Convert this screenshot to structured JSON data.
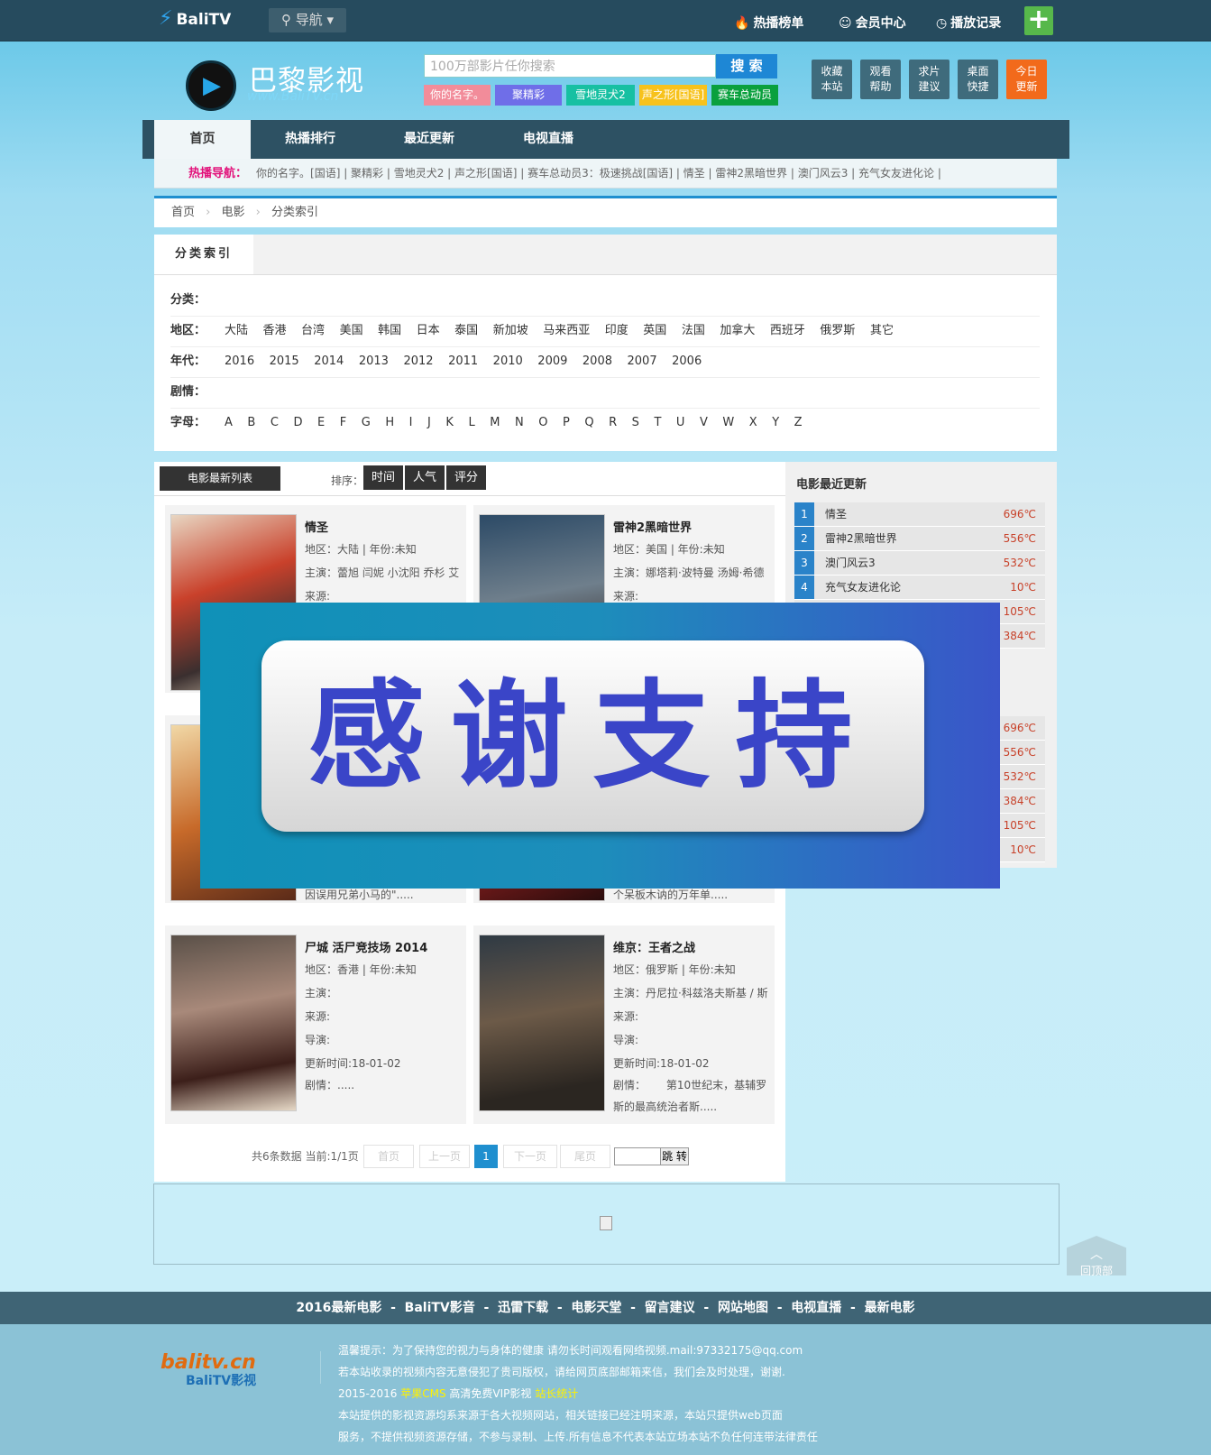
{
  "topbar": {
    "site_name": "BaliTV",
    "nav_dropdown": "导航",
    "links": [
      "热播榜单",
      "会员中心",
      "播放记录"
    ]
  },
  "header": {
    "logo_title": "巴黎影视",
    "logo_url": "www.BaliTV.cn",
    "search_placeholder": "100万部影片任你搜索",
    "search_button": "搜 索",
    "hot_tags": [
      "你的名字。",
      "聚精彩",
      "雪地灵犬2",
      "声之形[国语]",
      "赛车总动员"
    ],
    "tiles": [
      {
        "l1": "收藏",
        "l2": "本站"
      },
      {
        "l1": "观看",
        "l2": "帮助"
      },
      {
        "l1": "求片",
        "l2": "建议"
      },
      {
        "l1": "桌面",
        "l2": "快捷"
      },
      {
        "l1": "今日",
        "l2": "更新"
      }
    ]
  },
  "nav": {
    "tabs": [
      "首页",
      "热播排行",
      "最近更新",
      "电视直播"
    ],
    "hot_label": "热播导航：",
    "hot_items": "你的名字。[国语] | 聚精彩 | 雪地灵犬2 | 声之形[国语] | 赛车总动员3：极速挑战[国语] | 情圣 | 雷神2黑暗世界 | 澳门风云3 | 充气女友进化论 |"
  },
  "breadcrumb": [
    "首页",
    "电影",
    "分类索引"
  ],
  "filter": {
    "title": "分类索引",
    "rows": [
      {
        "key": "分类：",
        "values": ""
      },
      {
        "key": "地区：",
        "values": "大陆    香港    台湾    美国    韩国    日本    泰国    新加坡    马来西亚    印度    英国    法国    加拿大    西班牙    俄罗斯    其它"
      },
      {
        "key": "年代：",
        "values": "2016    2015    2014    2013    2012    2011    2010    2009    2008    2007    2006"
      },
      {
        "key": "剧情：",
        "values": ""
      },
      {
        "key": "字母：",
        "values": "A    B    C    D    E    F    G    H    I    J    K    L    M    N    O    P    Q    R    S    T    U    V    W    X    Y    Z"
      }
    ]
  },
  "list": {
    "header": "电影最新列表",
    "sort_label": "排序：",
    "sort_buttons": [
      "时间",
      "人气",
      "评分"
    ],
    "cards": [
      {
        "title": "情圣",
        "region": "地区：大陆 | 年份:未知",
        "cast": "主演：蕾旭 闫妮 小沈阳 乔杉 艾",
        "source": "来源:",
        "director": "",
        "updated": "",
        "plot": ""
      },
      {
        "title": "雷神2黑暗世界",
        "region": "地区：美国 | 年份:未知",
        "cast": "主演：娜塔莉·波特曼 汤姆·希德",
        "source": "来源:",
        "director": "",
        "updated": "",
        "plot": ""
      },
      {
        "title": "",
        "region": "",
        "cast": "",
        "source": "",
        "director": "",
        "updated": "",
        "plot": "因误用兄弟小马的\"....."
      },
      {
        "title": "",
        "region": "",
        "cast": "",
        "source": "",
        "director": "",
        "updated": "",
        "plot": "个呆板木讷的万年单....."
      },
      {
        "title": "尸城 活尸竞技场 2014",
        "region": "地区：香港 | 年份:未知",
        "cast": "主演：",
        "source": "来源:",
        "director": "导演:",
        "updated": "更新时间:18-01-02",
        "plot": "剧情：....."
      },
      {
        "title": "维京：王者之战",
        "region": "地区：俄罗斯 | 年份:未知",
        "cast": "主演：丹尼拉·科兹洛夫斯基 / 斯",
        "source": "来源:",
        "director": "导演:",
        "updated": "更新时间:18-01-02",
        "plot": "剧情：      第10世纪末，基辅罗",
        "plot2": "斯的最高统治者斯....."
      }
    ]
  },
  "sidebar": {
    "title": "电影最近更新",
    "top": [
      {
        "n": "1",
        "t": "情圣",
        "h": "696℃"
      },
      {
        "n": "2",
        "t": "雷神2黑暗世界",
        "h": "556℃"
      },
      {
        "n": "3",
        "t": "澳门风云3",
        "h": "532℃"
      },
      {
        "n": "4",
        "t": "充气女友进化论",
        "h": "10℃"
      },
      {
        "n": "",
        "t": "",
        "h": "105℃"
      },
      {
        "n": "",
        "t": "",
        "h": "384℃"
      }
    ],
    "bottom": [
      "696℃",
      "556℃",
      "532℃",
      "384℃",
      "105℃",
      "10℃"
    ]
  },
  "pager": {
    "info": "共6条数据 当前:1/1页",
    "first": "首页",
    "prev": "上一页",
    "current": "1",
    "next": "下一页",
    "last": "尾页",
    "jump": "跳 转"
  },
  "to_top": "回顶部",
  "footer": {
    "links": "2016最新电影  -  BaliTV影音  -  迅雷下载  -  电影天堂  -  留言建议  -  网站地图  -  电视直播  -  最新电影",
    "logo_main": "balitv.cn",
    "logo_sub": "BaliTV影视",
    "line1": "温馨提示：为了保持您的视力与身体的健康 请勿长时间观看网络视频.mail:97332175@qq.com",
    "line2": "若本站收录的视频内容无意侵犯了贵司版权，请给网页底部邮箱来信，我们会及时处理，谢谢.",
    "line3_a": "2015-2016 ",
    "line3_b": "苹果CMS",
    "line3_c": " 高清免费VIP影视 ",
    "line3_d": "站长统计",
    "line4": "本站提供的影视资源均系来源于各大视频网站，相关链接已经注明来源，本站只提供web页面",
    "line5": "服务，不提供视频资源存储，不参与录制、上传.所有信息不代表本站立场本站不负任何连带法律责任"
  },
  "overlay": {
    "text": "感谢支持"
  },
  "colors": {
    "accent": "#1f8fcf",
    "topbar": "#264b5e",
    "hot": "#e2117a",
    "overlay_text": "#3a45c8"
  }
}
